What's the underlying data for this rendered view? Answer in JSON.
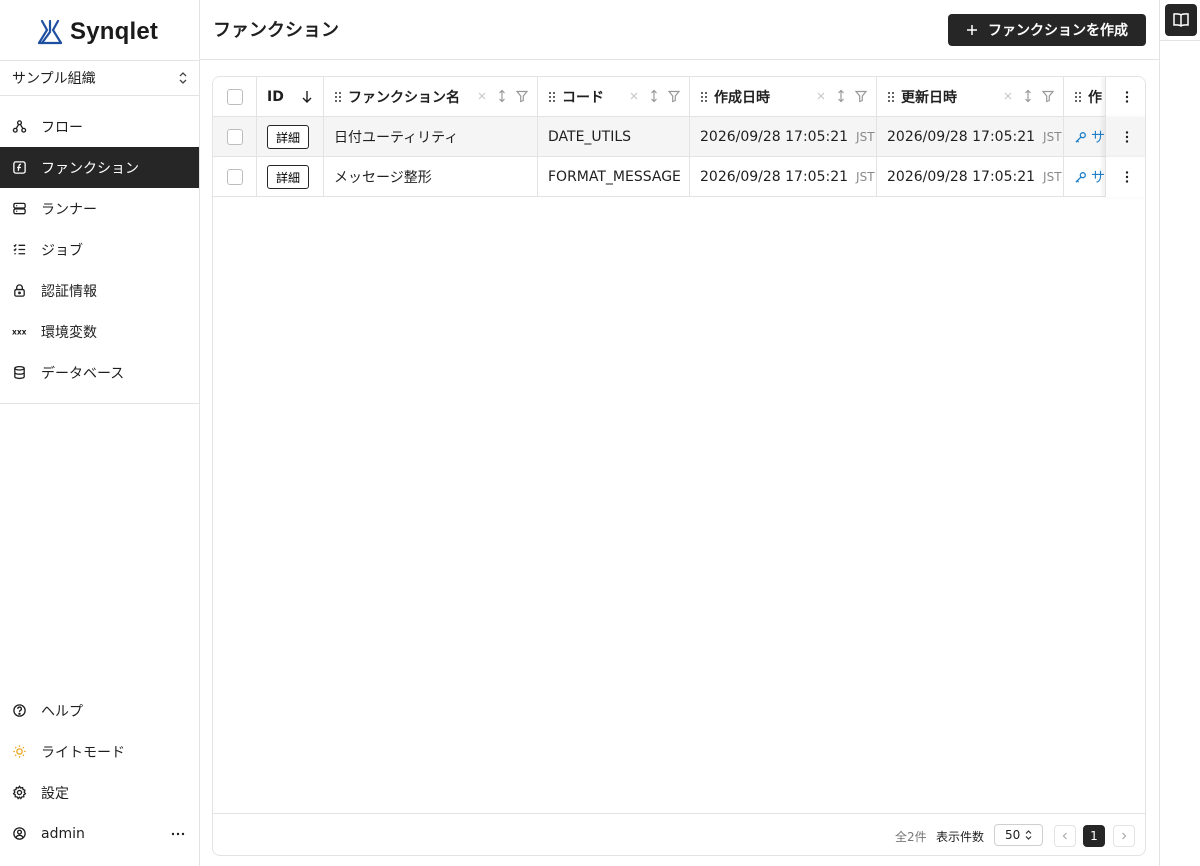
{
  "app": {
    "logo_text": "Synqlet"
  },
  "sidebar": {
    "org_selector": "サンプル組織",
    "items": [
      {
        "label": "フロー",
        "icon": "flow-icon"
      },
      {
        "label": "ファンクション",
        "icon": "function-icon",
        "active": true
      },
      {
        "label": "ランナー",
        "icon": "server-icon"
      },
      {
        "label": "ジョブ",
        "icon": "job-list-icon"
      },
      {
        "label": "認証情報",
        "icon": "lock-icon"
      },
      {
        "label": "環境変数",
        "icon": "variable-icon"
      },
      {
        "label": "データベース",
        "icon": "database-icon"
      }
    ],
    "bottom_items": [
      {
        "label": "ヘルプ",
        "icon": "help-icon"
      },
      {
        "label": "ライトモード",
        "icon": "sun-icon"
      },
      {
        "label": "設定",
        "icon": "gear-icon"
      },
      {
        "label": "admin",
        "icon": "user-icon"
      }
    ]
  },
  "header": {
    "title": "ファンクション",
    "create_button": "ファンクションを作成"
  },
  "table": {
    "columns": {
      "id": "ID",
      "name": "ファンクション名",
      "code": "コード",
      "created_at": "作成日時",
      "updated_at": "更新日時",
      "created_by": "作"
    },
    "rows": [
      {
        "detail": "詳細",
        "name": "日付ユーティリティ",
        "code": "DATE_UTILS",
        "created_at": "2026/09/28 17:05:21",
        "created_tz": "JST",
        "updated_at": "2026/09/28 17:05:21",
        "updated_tz": "JST",
        "created_by": "サ"
      },
      {
        "detail": "詳細",
        "name": "メッセージ整形",
        "code": "FORMAT_MESSAGE",
        "created_at": "2026/09/28 17:05:21",
        "created_tz": "JST",
        "updated_at": "2026/09/28 17:05:21",
        "updated_tz": "JST",
        "created_by": "サ"
      }
    ],
    "footer": {
      "total": "全2件",
      "per_page_label": "表示件数",
      "per_page_value": "50",
      "current_page": "1"
    }
  },
  "colors": {
    "primary": "#262626",
    "link": "#1e7fc8",
    "logo": "#1f4fa0"
  }
}
